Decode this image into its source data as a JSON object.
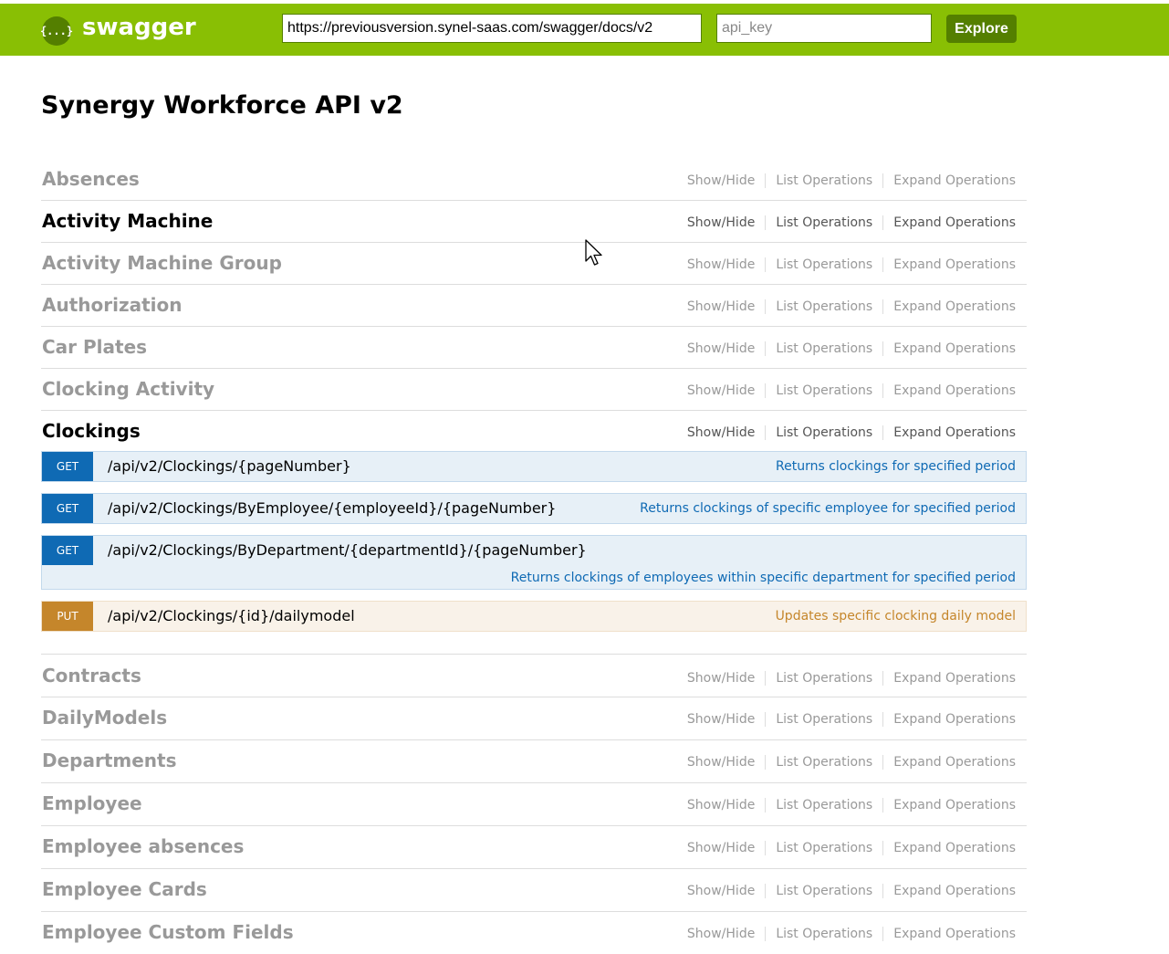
{
  "header": {
    "logo_icon": "{...}",
    "logo_text": "swagger",
    "url_value": "https://previousversion.synel-saas.com/swagger/docs/v2",
    "api_key_placeholder": "api_key",
    "explore_label": "Explore",
    "brand_color": "#89bf04"
  },
  "page": {
    "title": "Synergy Workforce API v2"
  },
  "links": {
    "show_hide": "Show/Hide",
    "list_operations": "List Operations",
    "expand_operations": "Expand Operations"
  },
  "resources_before": [
    {
      "name": "Absences"
    },
    {
      "name": "Activity Machine"
    },
    {
      "name": "Activity Machine Group"
    },
    {
      "name": "Authorization"
    },
    {
      "name": "Car Plates"
    },
    {
      "name": "Clocking Activity"
    }
  ],
  "clockings": {
    "name": "Clockings",
    "operations": [
      {
        "method": "GET",
        "path": "/api/v2/Clockings/{pageNumber}",
        "summary": "Returns clockings for specified period"
      },
      {
        "method": "GET",
        "path": "/api/v2/Clockings/ByEmployee/{employeeId}/{pageNumber}",
        "summary": "Returns clockings of specific employee for specified period"
      },
      {
        "method": "GET",
        "path": "/api/v2/Clockings/ByDepartment/{departmentId}/{pageNumber}",
        "summary": "Returns clockings of employees within specific department for specified period"
      },
      {
        "method": "PUT",
        "path": "/api/v2/Clockings/{id}/dailymodel",
        "summary": "Updates specific clocking daily model"
      }
    ]
  },
  "resources_after": [
    {
      "name": "Contracts"
    },
    {
      "name": "DailyModels"
    },
    {
      "name": "Departments"
    },
    {
      "name": "Employee"
    },
    {
      "name": "Employee absences"
    },
    {
      "name": "Employee Cards"
    },
    {
      "name": "Employee Custom Fields"
    }
  ],
  "colors": {
    "get": "#0f6ab4",
    "put": "#c5862b",
    "inactive_text": "#999999"
  }
}
